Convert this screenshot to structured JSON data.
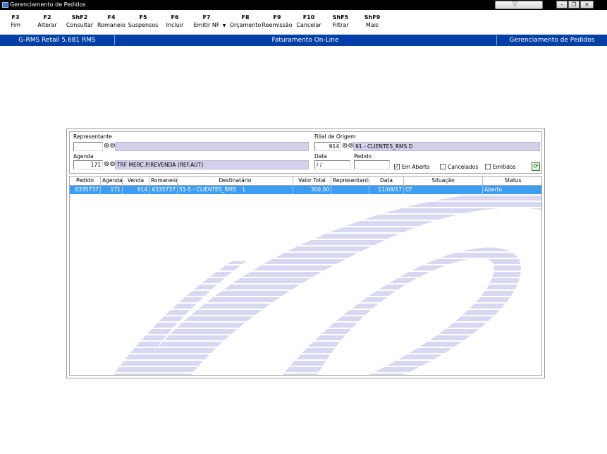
{
  "window": {
    "title": "Gerenciamento de Pedidos",
    "minimize_icon": "minimize-icon",
    "maximize_icon": "restore-icon",
    "close_icon": "close-icon"
  },
  "toolbar": [
    {
      "key": "F3",
      "label": "Fim"
    },
    {
      "key": "F2",
      "label": "Alterar"
    },
    {
      "key": "ShF2",
      "label": "Consultar"
    },
    {
      "key": "F4",
      "label": "Romaneio"
    },
    {
      "key": "F5",
      "label": "Suspensos"
    },
    {
      "key": "F6",
      "label": "Incluir"
    },
    {
      "key": "F7",
      "label": "Emitir NF"
    },
    {
      "key": "F8",
      "label": "Orçamento"
    },
    {
      "key": "F9",
      "label": "Reemissão"
    },
    {
      "key": "F10",
      "label": "Cancelar"
    },
    {
      "key": "ShF5",
      "label": "Filtrar"
    },
    {
      "key": "ShF9",
      "label": "Mais"
    }
  ],
  "statusbar": {
    "left": "G-RMS Retail 5.681 RMS",
    "center": "Faturamento On-Line",
    "right": "Gerenciamento de Pedidos"
  },
  "form": {
    "representante_label": "Representante",
    "representante_value": "",
    "representante_name": "",
    "filial_label": "Filial de Origem",
    "filial_value": "914",
    "filial_name": "91 - CLIENTES_RMS    D",
    "agenda_label": "Agenda",
    "agenda_value": "171",
    "agenda_name": "TRF MERC.P/REVENDA (REF.AUT)",
    "data_label": "Data",
    "data_value": " / /",
    "pedido_label": "Pedido",
    "pedido_value": "",
    "check_em_aberto": "Em Aberto",
    "check_cancelados": "Cancelados",
    "check_emitidos": "Emitidos",
    "em_aberto_checked": true,
    "cancelados_checked": false,
    "emitidos_checked": false
  },
  "grid": {
    "columns": [
      "Pedido",
      "Agenda",
      "Venda",
      "Romaneio",
      "Destinatário",
      "Valor Total",
      "Representante",
      "Data",
      "Situação",
      "Status"
    ],
    "rows": [
      [
        "6335737",
        "171",
        "914",
        "6335737",
        "51-5 - CLIENTES_RMS    L",
        "300,00",
        "",
        "11/09/17",
        "CF",
        "Aberto"
      ]
    ]
  },
  "colors": {
    "titlebar": "#000000",
    "statusbar": "#003fa6",
    "selected_row": "#3d9df2",
    "readonly_field": "#d4d0ea",
    "watermark": "#dcdcf4"
  }
}
